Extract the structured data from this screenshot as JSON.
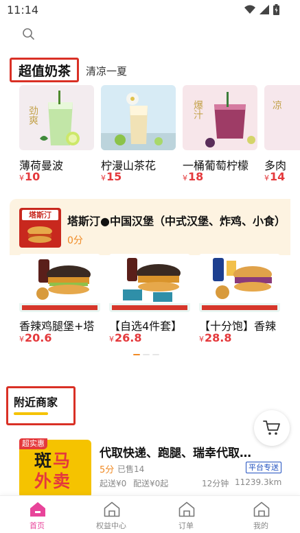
{
  "status_bar": {
    "time": "11:14"
  },
  "milk_tea": {
    "title": "超值奶茶",
    "subtitle": "清凉一夏",
    "items": [
      {
        "name": "薄荷曼波",
        "currency": "¥",
        "price": "10",
        "art_text": "劲爽",
        "color": "#f3ecef"
      },
      {
        "name": "柠漫山茶花",
        "currency": "¥",
        "price": "15",
        "art_text": "",
        "color": "#d7ebf5"
      },
      {
        "name": "一桶葡萄柠檬",
        "currency": "¥",
        "price": "18",
        "art_text": "爆汁",
        "color": "#f7e6ea"
      },
      {
        "name": "多肉",
        "currency": "¥",
        "price": "14",
        "art_text": "凉",
        "color": "#f6e7ec"
      }
    ]
  },
  "promo": {
    "store_name": "塔斯汀●中国汉堡（中式汉堡、炸鸡、小食）",
    "score": "0分",
    "logo_text": "塔斯汀",
    "combos": [
      {
        "name": "香辣鸡腿堡+塔",
        "currency": "¥",
        "price": "20.6"
      },
      {
        "name": "【自选4件套】",
        "currency": "¥",
        "price": "26.8"
      },
      {
        "name": "【十分饱】香辣",
        "currency": "¥",
        "price": "28.8"
      }
    ]
  },
  "nearby": {
    "title": "附近商家",
    "store": {
      "badge": "超实惠",
      "logo_line1_a": "斑",
      "logo_line1_b": "马",
      "logo_line2": "外卖",
      "name": "代取快递、跑腿、瑞幸代取…",
      "score": "5分",
      "sold": "已售14",
      "tag": "平台专送",
      "delivery_min": "起送¥0",
      "delivery_fee": "配送¥0起",
      "time": "12分钟",
      "distance": "11239.3km"
    }
  },
  "nav": {
    "items": [
      {
        "label": "首页",
        "active": true
      },
      {
        "label": "权益中心",
        "active": false
      },
      {
        "label": "订单",
        "active": false
      },
      {
        "label": "我的",
        "active": false
      }
    ]
  },
  "colors": {
    "accent_pink": "#e8449a",
    "price_red": "#e4393c",
    "orange": "#f08a24",
    "highlight_box": "#d93025"
  }
}
